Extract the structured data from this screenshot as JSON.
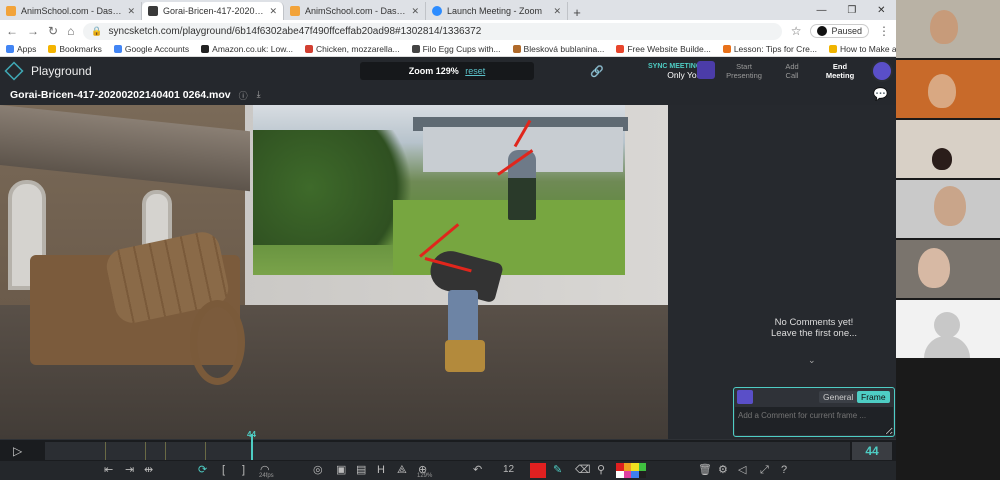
{
  "browser": {
    "tabs": [
      {
        "label": "AnimSchool.com - Dashboard",
        "active": false,
        "fav_color": "#f2a33a"
      },
      {
        "label": "Gorai-Bricen-417-20200202140401",
        "active": true,
        "fav_color": "#3a3a3a"
      },
      {
        "label": "AnimSchool.com - Dashboard",
        "active": false,
        "fav_color": "#f2a33a"
      },
      {
        "label": "Launch Meeting - Zoom",
        "active": false,
        "fav_color": "#2d8cff"
      }
    ],
    "url": "syncsketch.com/playground/6b14f6302abe47f490ffceffab20ad98#1302814/1336372",
    "paused_label": "Paused",
    "bookmarks": [
      {
        "label": "Apps",
        "color": "#4285f4"
      },
      {
        "label": "Bookmarks",
        "color": "#f4b400"
      },
      {
        "label": "Google Accounts",
        "color": "#4285f4"
      },
      {
        "label": "Amazon.co.uk: Low...",
        "color": "#222222"
      },
      {
        "label": "Chicken, mozzarella...",
        "color": "#d23f31"
      },
      {
        "label": "Filo Egg Cups with...",
        "color": "#444444"
      },
      {
        "label": "Blesková bublanina...",
        "color": "#b06a2a"
      },
      {
        "label": "Free Website Builde...",
        "color": "#e8452c"
      },
      {
        "label": "Lesson: Tips for Cre...",
        "color": "#e8711a"
      },
      {
        "label": "How to Make an A...",
        "color": "#f0b400"
      }
    ]
  },
  "app": {
    "title": "Playground",
    "zoom_label": "Zoom 129%",
    "reset_label": "reset",
    "sync_meeting_label": "SYNC MEETING",
    "sync_who": "Only You",
    "buttons": {
      "start_presenting": [
        "Start",
        "Presenting"
      ],
      "add_call": [
        "Add",
        "Call"
      ],
      "end_meeting": [
        "End",
        "Meeting"
      ]
    },
    "filename": "Gorai-Bricen-417-20200202140401 0264.mov"
  },
  "comments": {
    "empty_line1": "No Comments yet!",
    "empty_line2": "Leave the first one...",
    "mode_general": "General",
    "mode_frame": "Frame",
    "placeholder": "Add a Comment for current frame ..."
  },
  "timeline": {
    "current_frame": "44",
    "frame_display": "44",
    "fps_label": "24fps",
    "zoom_percent": "129%",
    "brush_size": "12"
  },
  "colors": {
    "accent": "#4ecdc4",
    "draw_color": "#e02020",
    "palette": [
      "#e02020",
      "#f0a020",
      "#f0e020",
      "#40c040",
      "#ffffff",
      "#e040a0",
      "#4080f0",
      "#202020"
    ]
  }
}
